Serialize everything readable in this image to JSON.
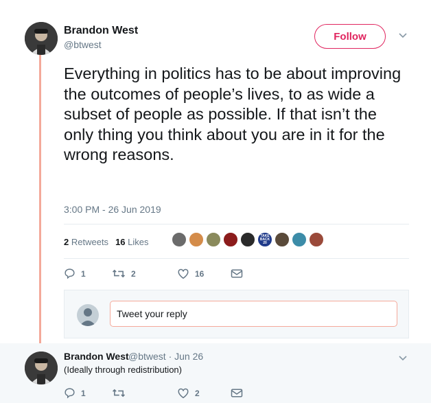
{
  "tweet": {
    "author_name": "Brandon West",
    "author_handle": "@btwest",
    "follow_label": "Follow",
    "text": "Everything in politics has to be about improving the outcomes of people’s lives, to as wide a subset of people as possible. If that isn’t the only thing you think about you are in it for the wrong reasons.",
    "timestamp": "3:00 PM - 26 Jun 2019",
    "retweets_count": "2",
    "retweets_label": "Retweets",
    "likes_count": "16",
    "likes_label": "Likes",
    "likers": [
      {
        "icon": "liker-avatar-1",
        "color": "#6b6b6b"
      },
      {
        "icon": "liker-avatar-2",
        "color": "#d48c4a"
      },
      {
        "icon": "liker-avatar-3",
        "color": "#8a8a5c"
      },
      {
        "icon": "liker-avatar-4",
        "color": "#8c1c1c"
      },
      {
        "icon": "liker-avatar-5",
        "color": "#2a2a2a"
      },
      {
        "icon": "liker-avatar-6",
        "color": "#1f3a8a",
        "text": "TAKE BACK 20"
      },
      {
        "icon": "liker-avatar-7",
        "color": "#5a4a3a"
      },
      {
        "icon": "liker-avatar-8",
        "color": "#3c8ca8"
      },
      {
        "icon": "liker-avatar-9",
        "color": "#9a4a3a"
      }
    ],
    "actions": {
      "reply_count": "1",
      "retweet_count": "2",
      "like_count": "16"
    }
  },
  "reply_composer": {
    "placeholder": "Tweet your reply"
  },
  "reply_tweet": {
    "author_name": "Brandon West",
    "author_handle": "@btwest · Jun 26",
    "text": "(Ideally through redistribution)",
    "actions": {
      "reply_count": "1",
      "retweet_count": "",
      "like_count": "2"
    }
  },
  "colors": {
    "accent": "#e0245e",
    "thread_line": "#f4a99a",
    "muted": "#657786"
  }
}
